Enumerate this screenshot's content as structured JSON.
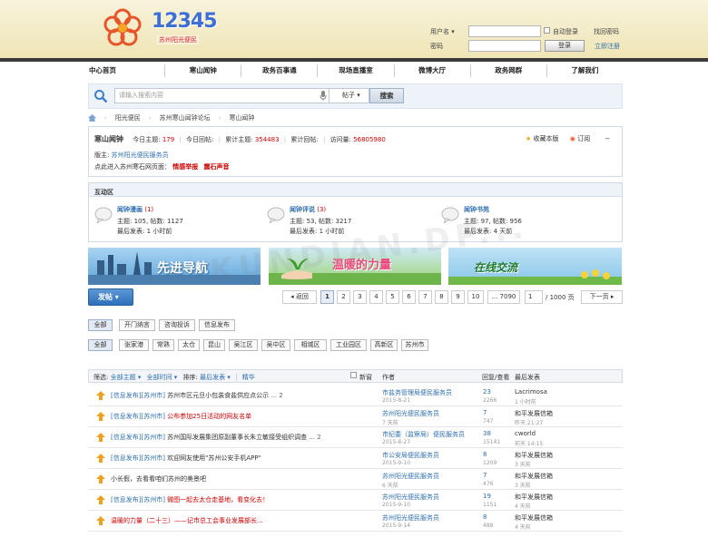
{
  "header": {
    "logo_number": "12345",
    "logo_subtitle": "苏州阳光便民",
    "username_label": "用户名",
    "password_label": "密码",
    "auto_login_label": "自动登录",
    "login_button": "登录",
    "forgot_password": "找回密码",
    "register_link": "立即注册"
  },
  "nav": {
    "items": [
      "中心首页",
      "寒山闻钟",
      "政务百事通",
      "现场直播室",
      "微博大厅",
      "政务网群",
      "了解我们"
    ]
  },
  "search": {
    "placeholder": "请输入搜索内容",
    "type_selected": "帖子",
    "button": "搜索"
  },
  "breadcrumb": {
    "items": [
      "阳光便民",
      "苏州寒山闻钟论坛",
      "寒山闻钟"
    ]
  },
  "forum_info": {
    "title": "寒山闻钟",
    "today_label": "今日主题:",
    "today_value": "179",
    "today_reply_label": "今日回帖:",
    "total_topics_label": "累计主题:",
    "total_topics_value": "354483",
    "total_reply_label": "累计回帖:",
    "visits_label": "访问量:",
    "visits_value": "56805980",
    "favorite_label": "收藏本版",
    "subscribe_label": "订阅",
    "moderator_label": "版主:",
    "moderator_value": "苏州阳光便民服务员",
    "link_text": "点此进入苏州寒石网页面：",
    "report_label": "情感举报",
    "voice_label": "震石声音"
  },
  "interaction": {
    "title": "互动区",
    "boards": [
      {
        "name": "闻钟漫画",
        "count": "(1)",
        "stats": "主题: 105, 帖数: 1127",
        "last": "最后发表: 1 小时前"
      },
      {
        "name": "闻钟评说",
        "count": "(3)",
        "stats": "主题: 53, 帖数: 3217",
        "last": "最后发表: 1 小时前"
      },
      {
        "name": "闻钟书苑",
        "count": "",
        "stats": "主题: 97, 帖数: 956",
        "last": "最后发表: 4 天前"
      }
    ]
  },
  "banners": {
    "b1": "先进导航",
    "b2": "温暖的力量",
    "b3": "在线交流"
  },
  "pager": {
    "post_button": "发帖",
    "prev": "返回",
    "pages": [
      "1",
      "2",
      "3",
      "4",
      "5",
      "6",
      "7",
      "8",
      "9",
      "10"
    ],
    "last": "... 7090",
    "current_input": "1",
    "total": "/ 1000 页",
    "next": "下一页"
  },
  "filters": {
    "type_tabs": [
      "全部",
      "开门纳言",
      "咨询投诉",
      "信息发布"
    ],
    "district_tabs": [
      "全部",
      "张家港",
      "常熟",
      "太仓",
      "昆山",
      "吴江区",
      "吴中区",
      "相城区",
      "工业园区",
      "高新区",
      "苏州市"
    ]
  },
  "list_header": {
    "filter_label": "筛选:",
    "all_topics": "全部主题",
    "all_time": "全部时间",
    "sort_label": "排序:",
    "sort_value": "最后发表",
    "digest": "精华",
    "new_window": "新窗",
    "author": "作者",
    "reply_view": "回复/查看",
    "last_post": "最后发表"
  },
  "threads": [
    {
      "tag1": "[信息发布]",
      "tag2": "[苏州市]",
      "title": "苏州市区元旦小包装食盐供应点公示",
      "suffix": "... 2",
      "title_color": "#333",
      "author": "市盐务管理局便民服务员",
      "date": "2015-8-21",
      "replies": "23",
      "views": "2266",
      "last_user": "Lacrimosa",
      "last_time": "1 小时前",
      "icon": "arrow-up"
    },
    {
      "tag1": "[信息发布]",
      "tag2": "[苏州市]",
      "title": "公布参加25日活动的网友名单",
      "suffix": "",
      "title_color": "#c00",
      "author": "苏州阳光便民服务员",
      "date": "7 天前",
      "replies": "7",
      "views": "747",
      "last_user": "和平发展信箱",
      "last_time": "昨天 21:27",
      "icon": "arrow-up"
    },
    {
      "tag1": "[信息发布]",
      "tag2": "[苏州市]",
      "title": "苏州国际发展集团原副董事长朱立敏接受组织调查",
      "suffix": "... 2",
      "title_color": "#333",
      "author": "市纪委（监察局）便民服务员",
      "date": "2015-8-27",
      "replies": "38",
      "views": "15141",
      "last_user": "cworld",
      "last_time": "前天 14:15",
      "icon": "arrow-up"
    },
    {
      "tag1": "[信息发布]",
      "tag2": "[苏州市]",
      "title": "欢迎网友使用\"苏州公安手机APP\"",
      "suffix": "",
      "title_color": "#333",
      "author": "市公安局便民服务员",
      "date": "2015-9-10",
      "replies": "8",
      "views": "1209",
      "last_user": "和平发展信箱",
      "last_time": "3 天前",
      "icon": "arrow-up"
    },
    {
      "tag1": "",
      "tag2": "",
      "title": "小长假，去看看咱们苏州的美景吧",
      "suffix": "",
      "title_color": "#333",
      "author": "苏州阳光便民服务员",
      "date": "6 天前",
      "replies": "7",
      "views": "476",
      "last_user": "和平发展信箱",
      "last_time": "3 天前",
      "icon": "arrow-up"
    },
    {
      "tag1": "[信息发布]",
      "tag2": "[苏州市]",
      "title": "微图一起去太仓走基地，看变化去！",
      "suffix": "",
      "title_color": "#c00",
      "author": "苏州阳光便民服务员",
      "date": "2015-9-10",
      "replies": "19",
      "views": "1151",
      "last_user": "和平发展信箱",
      "last_time": "4 天前",
      "icon": "arrow-up"
    },
    {
      "tag1": "",
      "tag2": "",
      "title": "温暖的力量（二十三）——记市总工会事业发展部长...",
      "suffix": "",
      "title_color": "#c00",
      "author": "苏州阳光便民服务员",
      "date": "2015-9-14",
      "replies": "8",
      "views": "488",
      "last_user": "和平发展信箱",
      "last_time": "4 天前",
      "icon": "arrow-up"
    }
  ],
  "colors": {
    "link_blue": "#2f6fb0",
    "highlight_red": "#c00",
    "header_bg": "#efe5b6",
    "post_button": "#3d7fc9"
  }
}
